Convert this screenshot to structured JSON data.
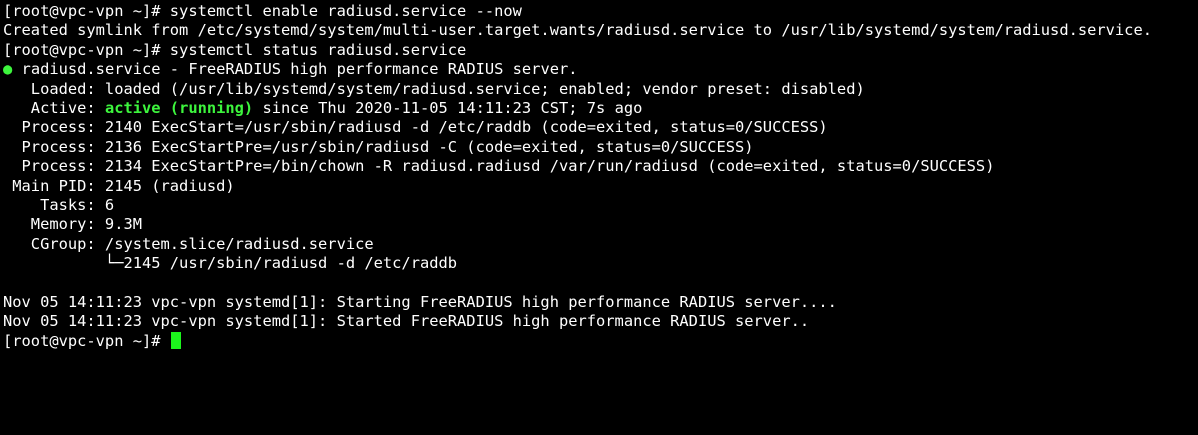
{
  "terminal": {
    "lines": [
      "[root@vpc-vpn ~]# systemctl enable radiusd.service --now",
      "Created symlink from /etc/systemd/system/multi-user.target.wants/radiusd.service to /usr/lib/systemd/system/radiusd.service.",
      "[root@vpc-vpn ~]# systemctl status radiusd.service"
    ],
    "status": {
      "bullet": "●",
      "title": " radiusd.service - FreeRADIUS high performance RADIUS server.",
      "loaded": "   Loaded: loaded (/usr/lib/systemd/system/radiusd.service; enabled; vendor preset: disabled)",
      "active_prefix": "   Active: ",
      "active_state": "active (running)",
      "active_suffix": " since Thu 2020-11-05 14:11:23 CST; 7s ago",
      "details": [
        "  Process: 2140 ExecStart=/usr/sbin/radiusd -d /etc/raddb (code=exited, status=0/SUCCESS)",
        "  Process: 2136 ExecStartPre=/usr/sbin/radiusd -C (code=exited, status=0/SUCCESS)",
        "  Process: 2134 ExecStartPre=/bin/chown -R radiusd.radiusd /var/run/radiusd (code=exited, status=0/SUCCESS)",
        " Main PID: 2145 (radiusd)",
        "    Tasks: 6",
        "   Memory: 9.3M",
        "   CGroup: /system.slice/radiusd.service",
        "           └─2145 /usr/sbin/radiusd -d /etc/raddb"
      ]
    },
    "log": [
      "Nov 05 14:11:23 vpc-vpn systemd[1]: Starting FreeRADIUS high performance RADIUS server....",
      "Nov 05 14:11:23 vpc-vpn systemd[1]: Started FreeRADIUS high performance RADIUS server.."
    ],
    "prompt": "[root@vpc-vpn ~]# "
  },
  "colors": {
    "background": "#000000",
    "foreground": "#ffffff",
    "active_green": "#3df53d",
    "cursor_green": "#1cf51c"
  }
}
